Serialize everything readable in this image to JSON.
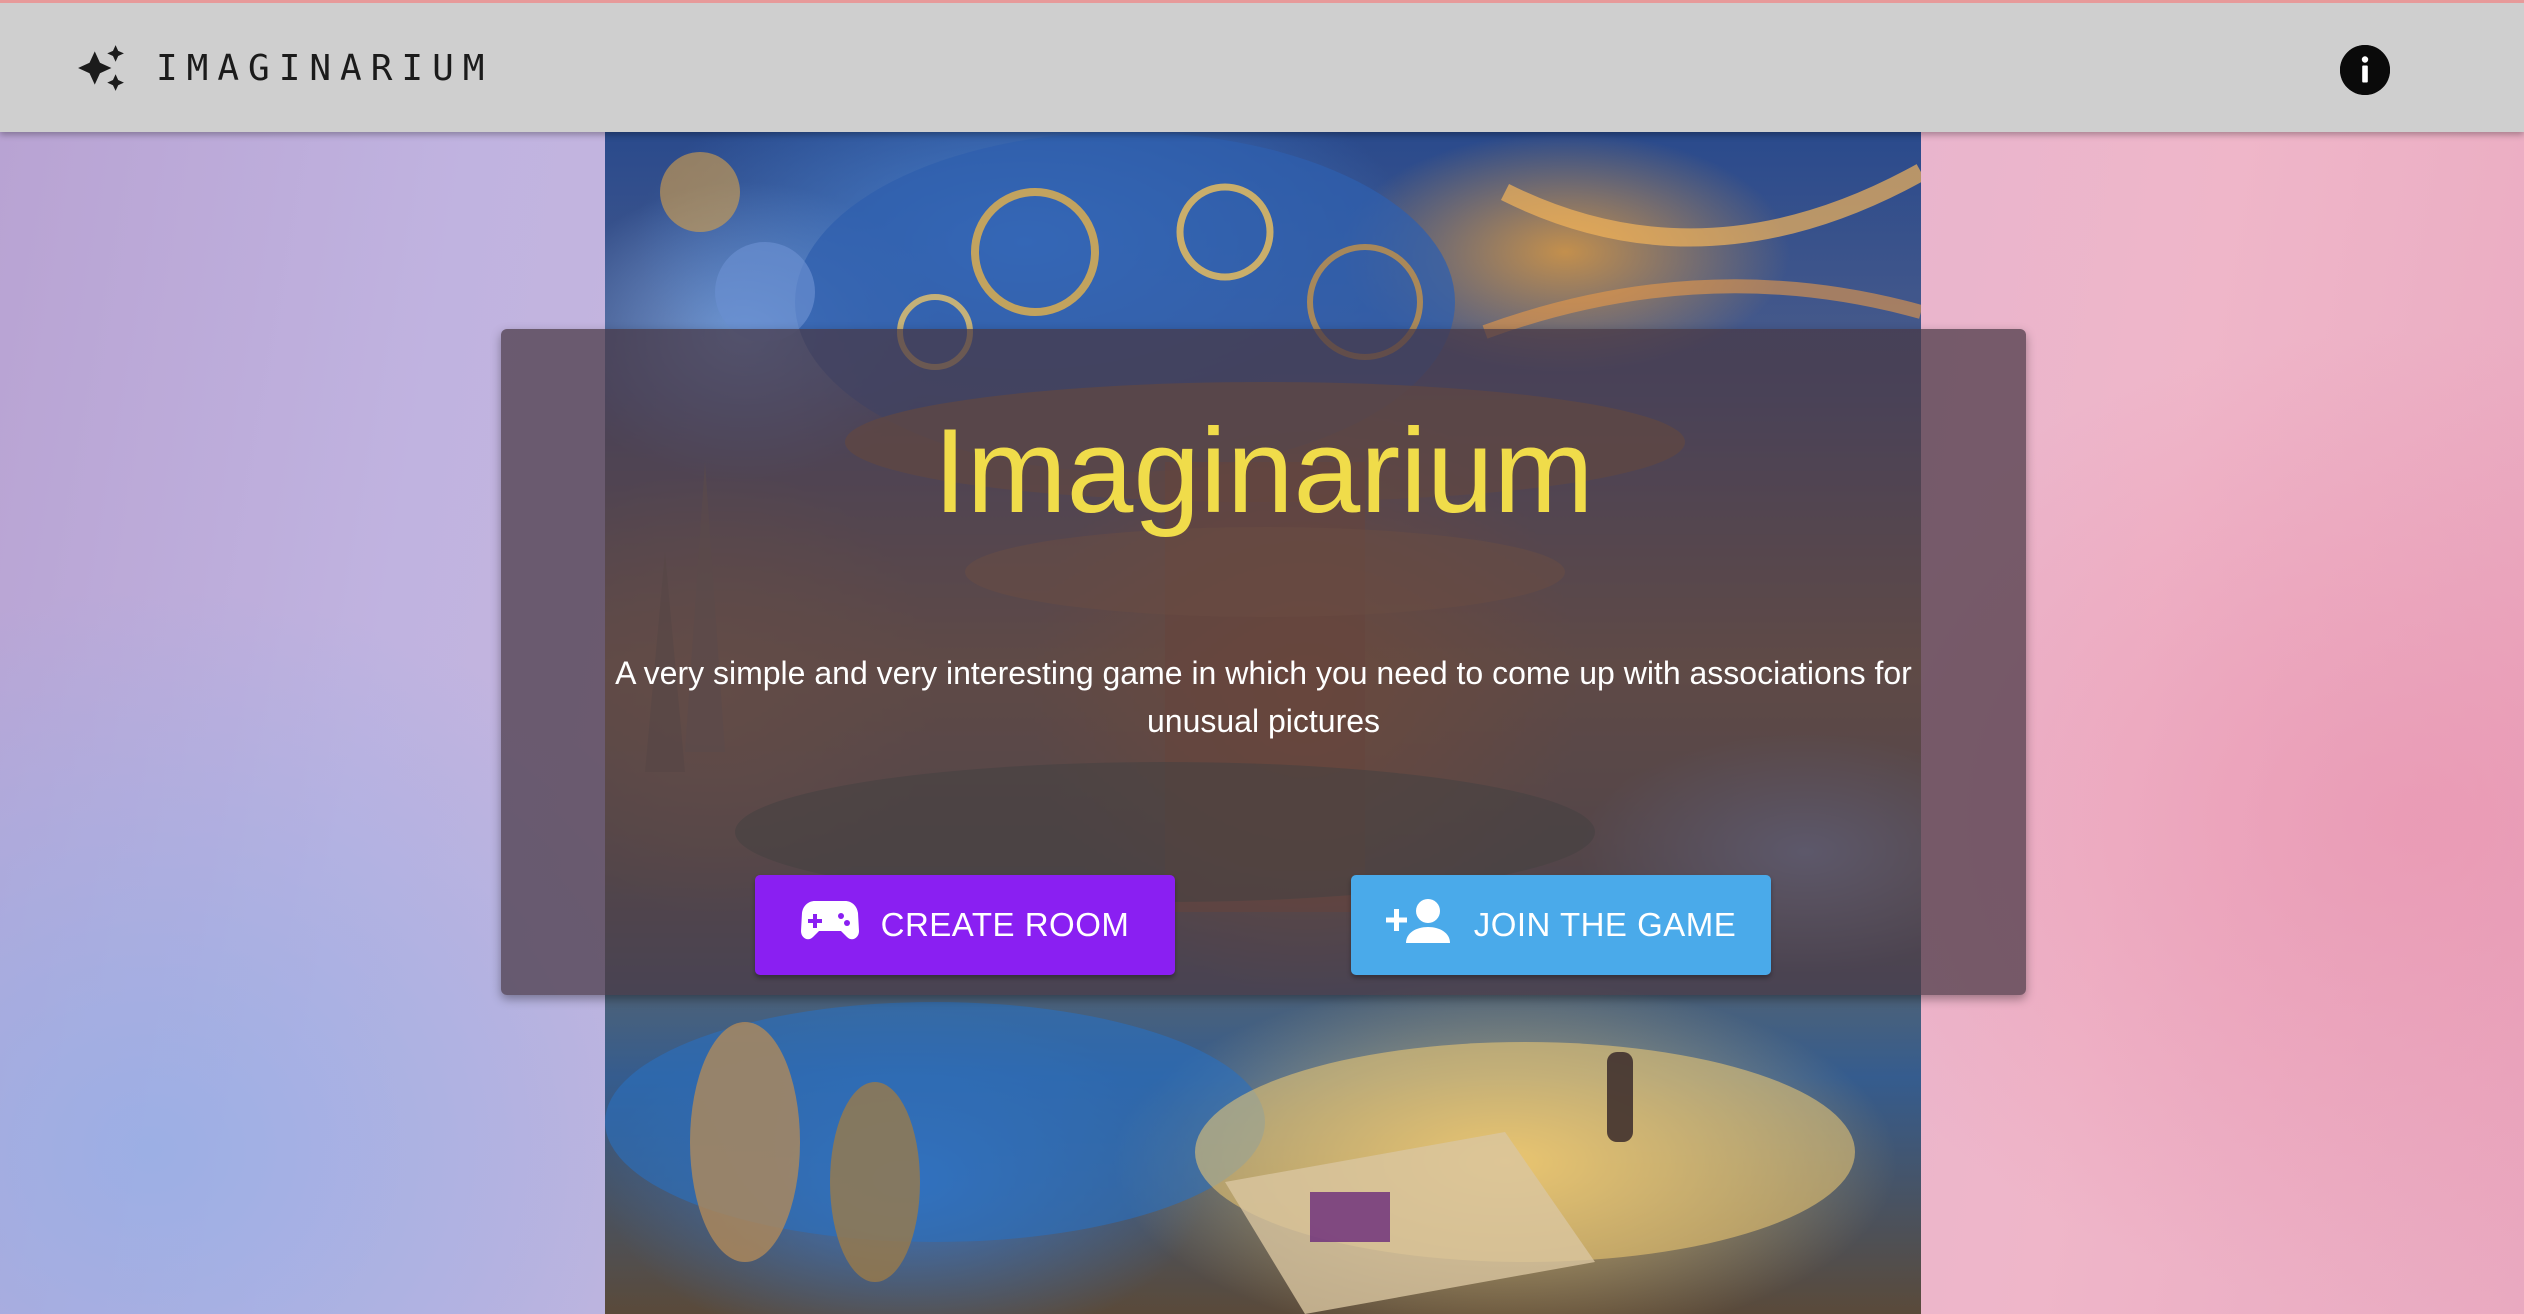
{
  "app_bar": {
    "brand_icon": "auto-awesome-sparkles-icon",
    "title": "IMAGINARIUM",
    "info_icon": "info-icon"
  },
  "hero": {
    "title": "Imaginarium",
    "description": "A very simple and very interesting game in which you need to come up with associations for unusual pictures",
    "buttons": {
      "create_room": {
        "label": "CREATE ROOM",
        "icon": "gamepad-icon"
      },
      "join_game": {
        "label": "JOIN THE GAME",
        "icon": "person-add-icon"
      }
    }
  },
  "colors": {
    "app_bar_bg": "#cfcfcf",
    "title_yellow": "#f0dc4a",
    "create_button": "#8a1ff2",
    "join_button": "#4aaaea"
  }
}
